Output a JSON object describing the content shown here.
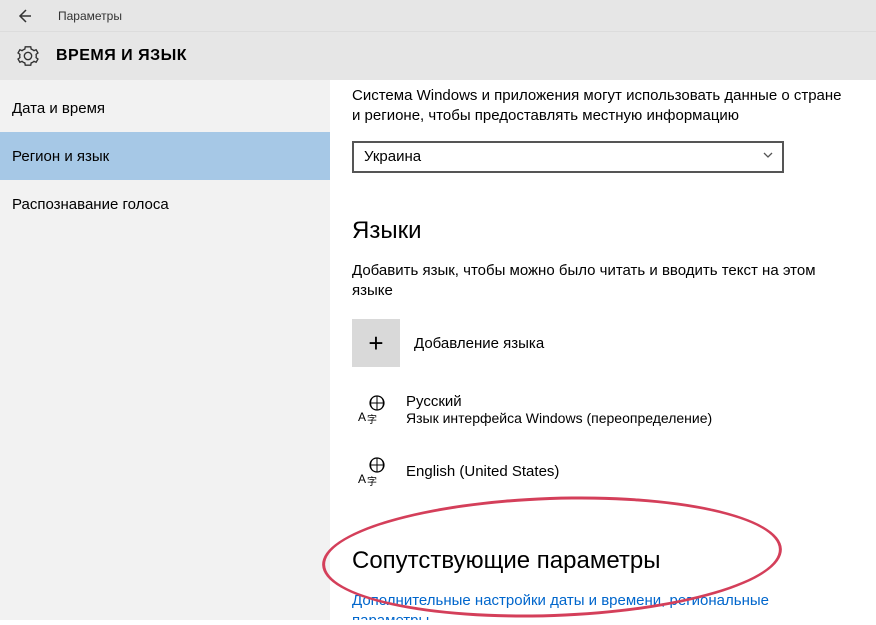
{
  "titlebar": {
    "title": "Параметры"
  },
  "header": {
    "title": "ВРЕМЯ И ЯЗЫК"
  },
  "sidebar": {
    "items": [
      {
        "label": "Дата и время",
        "active": false
      },
      {
        "label": "Регион и язык",
        "active": true
      },
      {
        "label": "Распознавание голоса",
        "active": false
      }
    ]
  },
  "main": {
    "region_description": "Система Windows и приложения могут использовать данные о стране и регионе, чтобы предоставлять местную информацию",
    "region_dropdown": {
      "selected": "Украина"
    },
    "languages_heading": "Языки",
    "languages_description": "Добавить язык, чтобы можно было читать и вводить текст на этом языке",
    "add_language_label": "Добавление языка",
    "languages": [
      {
        "name": "Русский",
        "subtitle": "Язык интерфейса Windows (переопределение)"
      },
      {
        "name": "English (United States)",
        "subtitle": ""
      }
    ],
    "related_heading": "Сопутствующие параметры",
    "related_link": "Дополнительные настройки даты и времени, региональные параметры"
  }
}
